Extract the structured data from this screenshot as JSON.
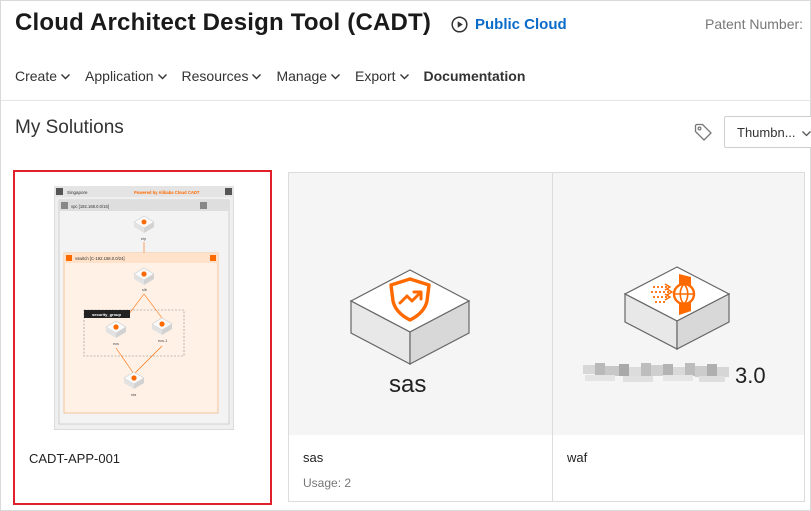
{
  "header": {
    "title": "Cloud Architect Design Tool (CADT)",
    "cloud_label": "Public Cloud",
    "patent_label": "Patent Number:"
  },
  "nav": {
    "items": [
      {
        "label": "Create"
      },
      {
        "label": "Application"
      },
      {
        "label": "Resources"
      },
      {
        "label": "Manage"
      },
      {
        "label": "Export"
      },
      {
        "label": "Documentation"
      }
    ]
  },
  "main": {
    "title": "My Solutions",
    "view_select": "Thumbn..."
  },
  "cards": [
    {
      "name": "CADT-APP-001",
      "selected": true,
      "diagram": {
        "region": "Singapore",
        "powered": "Powered by Alibaba Cloud CADT",
        "vpc": "vpc [192.168.0.0/16]",
        "eip": "eip",
        "vswitch": "vswitch [C-192.168.0.0/24]",
        "slb": "slb",
        "security_group": "security_group",
        "ecs1": "ecs",
        "ecs2": "ecs-1",
        "rds": "rds"
      }
    },
    {
      "name": "sas",
      "usage": "Usage: 2",
      "thumb_text": "sas"
    },
    {
      "name": "waf",
      "thumb_text_suffix": "3.0"
    }
  ],
  "colors": {
    "accent_orange": "#ff6a00",
    "link_blue": "#0a6bc9",
    "selected_border": "#e0202a"
  }
}
